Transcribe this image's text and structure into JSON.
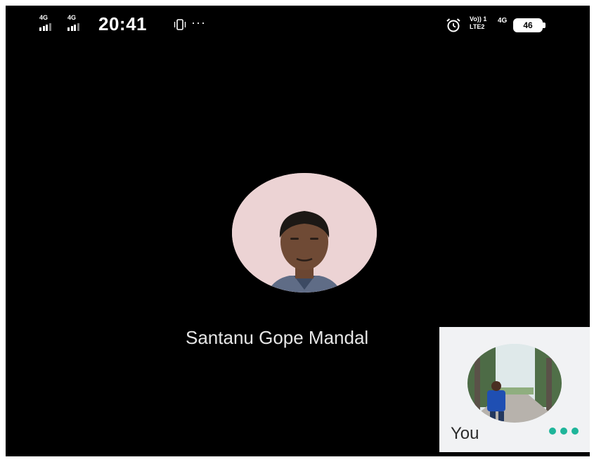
{
  "status_bar": {
    "sim1_network": "4G",
    "sim2_network": "4G",
    "time": "20:41",
    "more_indicator": "···",
    "volte_line1": "Vo)) 1",
    "volte_line2": "LTE2",
    "data_network": "4G",
    "battery_level": "46",
    "icons": [
      "vibrate-icon",
      "alarm-icon",
      "volte-icon",
      "battery-icon"
    ]
  },
  "call": {
    "caller_name": "Santanu Gope Mandal"
  },
  "self_view": {
    "label": "You",
    "accent_color": "#1fb59a"
  }
}
